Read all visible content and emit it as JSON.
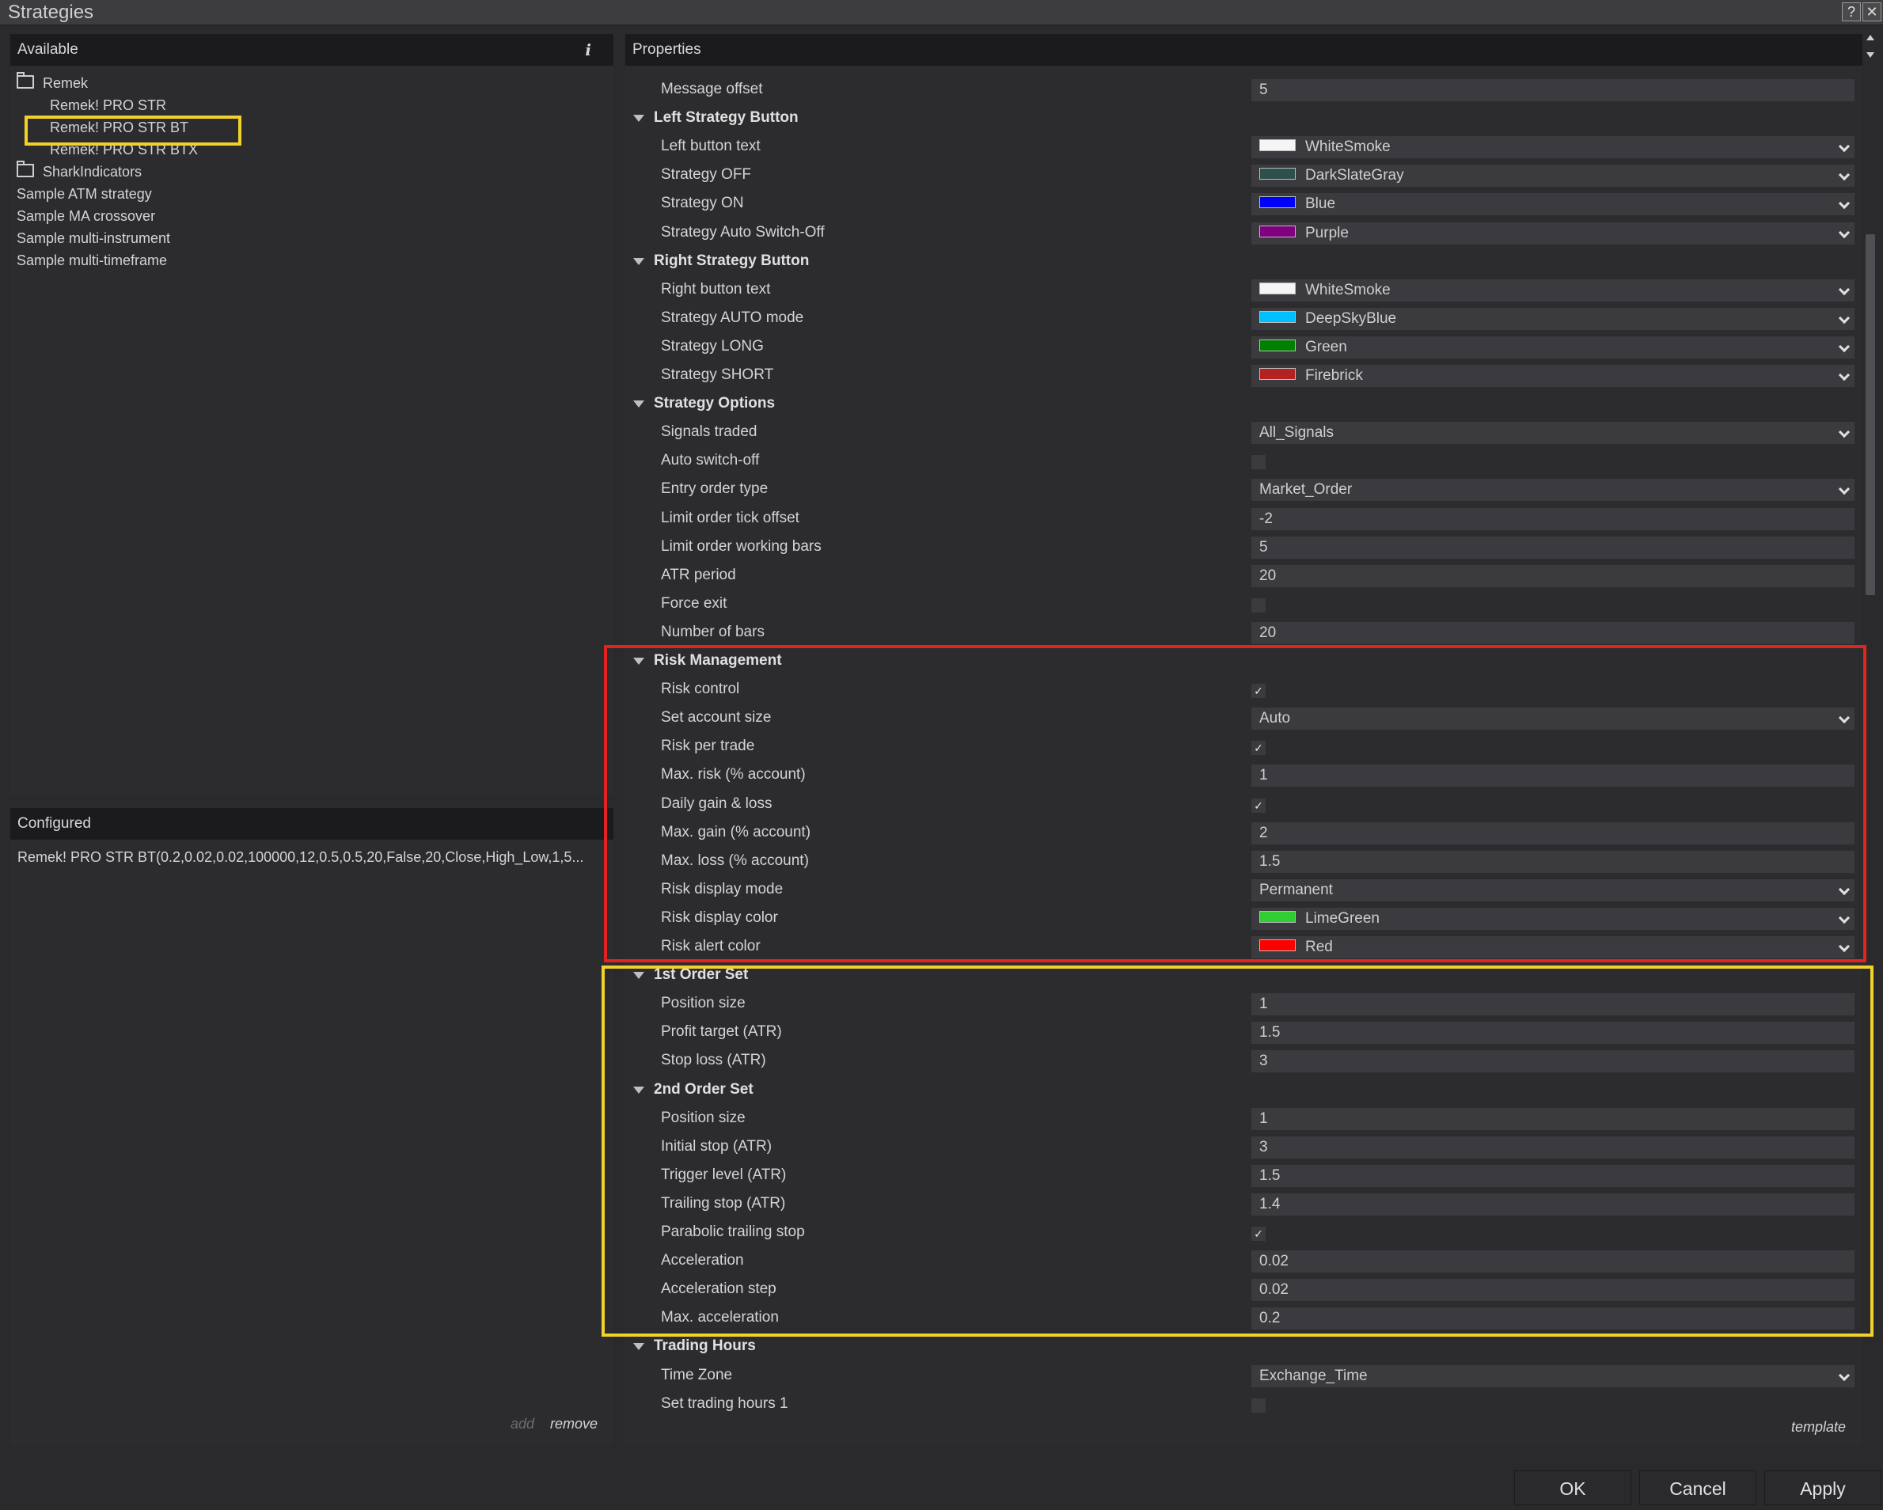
{
  "window": {
    "title": "Strategies",
    "help_label": "?",
    "close_label": "✕"
  },
  "available": {
    "header": "Available",
    "info_label": "i",
    "tree": [
      {
        "label": "Remek",
        "type": "folder"
      },
      {
        "label": "Remek! PRO STR",
        "type": "item"
      },
      {
        "label": "Remek! PRO STR BT",
        "type": "item",
        "selected": true
      },
      {
        "label": "Remek! PRO STR BTX",
        "type": "item"
      },
      {
        "label": "SharkIndicators",
        "type": "folder"
      },
      {
        "label": "Sample ATM strategy",
        "type": "item"
      },
      {
        "label": "Sample MA crossover",
        "type": "item"
      },
      {
        "label": "Sample multi-instrument",
        "type": "item"
      },
      {
        "label": "Sample multi-timeframe",
        "type": "item"
      }
    ]
  },
  "configured": {
    "header": "Configured",
    "item": "Remek! PRO STR BT(0.2,0.02,0.02,100000,12,0.5,0.5,20,False,20,Close,High_Low,1,5...",
    "add_label": "add",
    "remove_label": "remove"
  },
  "properties": {
    "header": "Properties",
    "template_label": "template",
    "rows": [
      {
        "kind": "text",
        "label": "Message offset",
        "value": "5"
      },
      {
        "kind": "cat",
        "label": "Left Strategy Button"
      },
      {
        "kind": "color",
        "label": "Left button text",
        "value": "WhiteSmoke",
        "color": "#F5F5F5"
      },
      {
        "kind": "color",
        "label": "Strategy OFF",
        "value": "DarkSlateGray",
        "color": "#2F4F4F"
      },
      {
        "kind": "color",
        "label": "Strategy ON",
        "value": "Blue",
        "color": "#0000FF"
      },
      {
        "kind": "color",
        "label": "Strategy Auto Switch-Off",
        "value": "Purple",
        "color": "#800080"
      },
      {
        "kind": "cat",
        "label": "Right Strategy Button"
      },
      {
        "kind": "color",
        "label": "Right button text",
        "value": "WhiteSmoke",
        "color": "#F5F5F5"
      },
      {
        "kind": "color",
        "label": "Strategy AUTO mode",
        "value": "DeepSkyBlue",
        "color": "#00BFFF"
      },
      {
        "kind": "color",
        "label": "Strategy LONG",
        "value": "Green",
        "color": "#008000"
      },
      {
        "kind": "color",
        "label": "Strategy SHORT",
        "value": "Firebrick",
        "color": "#B22222"
      },
      {
        "kind": "cat",
        "label": "Strategy Options"
      },
      {
        "kind": "select",
        "label": "Signals traded",
        "value": "All_Signals"
      },
      {
        "kind": "check",
        "label": "Auto switch-off",
        "checked": false
      },
      {
        "kind": "select",
        "label": "Entry order type",
        "value": "Market_Order"
      },
      {
        "kind": "text",
        "label": "Limit order tick offset",
        "value": "-2"
      },
      {
        "kind": "text",
        "label": "Limit order working bars",
        "value": "5"
      },
      {
        "kind": "text",
        "label": "ATR period",
        "value": "20"
      },
      {
        "kind": "check",
        "label": "Force exit",
        "checked": false
      },
      {
        "kind": "text",
        "label": "Number of bars",
        "value": "20"
      },
      {
        "kind": "cat",
        "label": "Risk Management"
      },
      {
        "kind": "check",
        "label": "Risk control",
        "checked": true
      },
      {
        "kind": "select",
        "label": "Set account size",
        "value": "Auto"
      },
      {
        "kind": "check",
        "label": "Risk per trade",
        "checked": true
      },
      {
        "kind": "text",
        "label": "Max. risk (% account)",
        "value": "1"
      },
      {
        "kind": "check",
        "label": "Daily gain & loss",
        "checked": true
      },
      {
        "kind": "text",
        "label": "Max. gain (% account)",
        "value": "2"
      },
      {
        "kind": "text",
        "label": "Max. loss (% account)",
        "value": "1.5"
      },
      {
        "kind": "select",
        "label": "Risk display mode",
        "value": "Permanent"
      },
      {
        "kind": "color",
        "label": "Risk display color",
        "value": "LimeGreen",
        "color": "#32CD32"
      },
      {
        "kind": "color",
        "label": "Risk alert color",
        "value": "Red",
        "color": "#FF0000"
      },
      {
        "kind": "cat",
        "label": "1st Order Set"
      },
      {
        "kind": "text",
        "label": "Position size",
        "value": "1"
      },
      {
        "kind": "text",
        "label": "Profit target (ATR)",
        "value": "1.5"
      },
      {
        "kind": "text",
        "label": "Stop loss (ATR)",
        "value": "3"
      },
      {
        "kind": "cat",
        "label": "2nd Order Set"
      },
      {
        "kind": "text",
        "label": "Position size",
        "value": "1"
      },
      {
        "kind": "text",
        "label": "Initial stop (ATR)",
        "value": "3"
      },
      {
        "kind": "text",
        "label": "Trigger level (ATR)",
        "value": "1.5"
      },
      {
        "kind": "text",
        "label": "Trailing stop (ATR)",
        "value": "1.4"
      },
      {
        "kind": "check",
        "label": "Parabolic trailing stop",
        "checked": true
      },
      {
        "kind": "text",
        "label": "Acceleration",
        "value": "0.02"
      },
      {
        "kind": "text",
        "label": "Acceleration step",
        "value": "0.02"
      },
      {
        "kind": "text",
        "label": "Max. acceleration",
        "value": "0.2"
      },
      {
        "kind": "cat",
        "label": "Trading Hours"
      },
      {
        "kind": "select",
        "label": "Time Zone",
        "value": "Exchange_Time"
      },
      {
        "kind": "check",
        "label": "Set trading hours 1",
        "checked": false
      }
    ]
  },
  "footer": {
    "ok_label": "OK",
    "cancel_label": "Cancel",
    "apply_label": "Apply"
  }
}
